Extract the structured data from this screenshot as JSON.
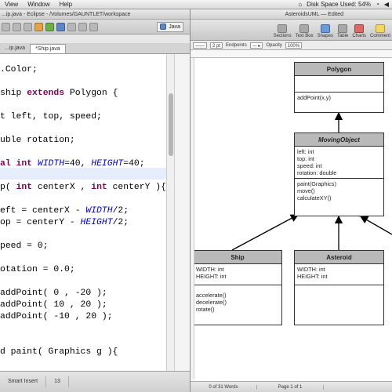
{
  "menubar": {
    "items": [
      "View",
      "Window",
      "Help"
    ],
    "disk_space": "Disk Space Used: 54%"
  },
  "eclipse": {
    "title": "...ip.java - Eclipse - /Volumes/GAUNTLET/workspace",
    "perspective": "Java",
    "tabs": [
      "...ip.java",
      "*Ship.java"
    ],
    "code_lines": [
      ".Color;",
      "",
      "ship extends Polygon {",
      "",
      "t left, top, speed;",
      "",
      "uble rotation;",
      "",
      "al int WIDTH=40, HEIGHT=40;",
      "",
      "p( int centerX , int centerY ){",
      "",
      "eft = centerX - WIDTH/2;",
      "op = centerY - HEIGHT/2;",
      "",
      "peed = 0;",
      "",
      "otation = 0.0;",
      "",
      "addPoint( 0 , -20 );",
      "addPoint( 10 , 20 );",
      "addPoint( -10 , 20 );",
      "",
      "",
      "d paint( Graphics g ){"
    ],
    "status": {
      "insert_mode": "Smart Insert",
      "position": "13"
    }
  },
  "pages": {
    "title": "AsteroidsUML — Edited",
    "toolbar": [
      "Sections",
      "Text Box",
      "Shapes",
      "Table",
      "Charts",
      "Comment"
    ],
    "format_bar": {
      "line_size": "2 pt",
      "endpoints": "Endpoints",
      "opacity_label": "Opacity",
      "opacity": "100%"
    },
    "status": {
      "words": "0 of 31 Words",
      "page": "Page 1 of 1"
    },
    "uml": {
      "polygon": {
        "name": "Polygon",
        "attributes": [],
        "methods": [
          "addPoint(x,y)"
        ]
      },
      "moving": {
        "name": "MovingObject",
        "attributes": [
          "left: int",
          "top: int",
          "speed: int",
          "rotation: double"
        ],
        "methods": [
          "paint(Graphics)",
          "move()",
          "calculateXY()"
        ]
      },
      "ship": {
        "name": "Ship",
        "attributes": [
          "WIDTH: int",
          "HEIGHT: int"
        ],
        "methods": [
          "accelerate()",
          "decelerate()",
          "rotate()"
        ]
      },
      "asteroid": {
        "name": "Asteroid",
        "attributes": [
          "WIDTH: int",
          "HEIGHT: int"
        ]
      }
    }
  }
}
